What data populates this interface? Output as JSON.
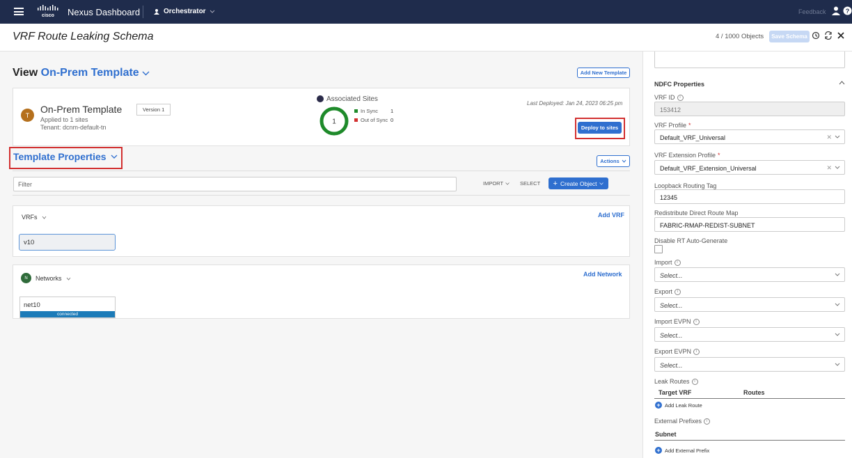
{
  "topbar": {
    "app_title": "Nexus Dashboard",
    "service": "Orchestrator",
    "feedback": "Feedback"
  },
  "header": {
    "title": "VRF Route Leaking Schema",
    "object_count": "4 / 1000 Objects",
    "save_label": "Save Schema"
  },
  "view": {
    "prefix": "View",
    "template_name": "On-Prem Template",
    "add_template_label": "Add New Template"
  },
  "template": {
    "avatar_letter": "T",
    "name": "On-Prem Template",
    "version": "Version 1",
    "applied": "Applied to 1 sites",
    "tenant": "Tenant: dcnm-default-tn",
    "associated_sites_label": "Associated Sites",
    "site_count": "1",
    "in_sync_label": "In Sync",
    "in_sync_count": "1",
    "out_of_sync_label": "Out of Sync",
    "out_of_sync_count": "0",
    "last_deployed": "Last Deployed: Jan 24, 2023 06:25 pm",
    "deploy_label": "Deploy to sites"
  },
  "template_properties": {
    "title": "Template Properties",
    "actions_label": "Actions",
    "filter_placeholder": "Filter",
    "import_label": "IMPORT",
    "select_label": "SELECT",
    "create_object_label": "Create Object"
  },
  "vrfs": {
    "title": "VRFs",
    "add_label": "Add VRF",
    "items": [
      "v10"
    ]
  },
  "networks": {
    "avatar_letter": "N",
    "title": "Networks",
    "add_label": "Add Network",
    "items": [
      {
        "name": "net10",
        "status": "connected"
      }
    ]
  },
  "ndfc": {
    "title": "NDFC Properties",
    "vrf_id_label": "VRF ID",
    "vrf_id_value": "153412",
    "vrf_profile_label": "VRF Profile",
    "vrf_profile_value": "Default_VRF_Universal",
    "vrf_ext_profile_label": "VRF Extension Profile",
    "vrf_ext_profile_value": "Default_VRF_Extension_Universal",
    "loopback_label": "Loopback Routing Tag",
    "loopback_value": "12345",
    "redistribute_label": "Redistribute Direct Route Map",
    "redistribute_value": "FABRIC-RMAP-REDIST-SUBNET",
    "disable_rt_label": "Disable RT Auto-Generate",
    "import_label": "Import",
    "export_label": "Export",
    "import_evpn_label": "Import EVPN",
    "export_evpn_label": "Export EVPN",
    "select_placeholder": "Select...",
    "leak_routes_label": "Leak Routes",
    "target_vrf_header": "Target VRF",
    "routes_header": "Routes",
    "add_leak_route_label": "Add Leak Route",
    "external_prefixes_label": "External Prefixes",
    "subnet_header": "Subnet",
    "add_external_prefix_label": "Add External Prefix"
  },
  "colors": {
    "topbar": "#1f2c4c",
    "accent": "#2f6fcf",
    "highlight": "#d22f2f",
    "in_sync": "#1e8a2a",
    "out_of_sync": "#d22f2f",
    "connected": "#1c7bb8"
  }
}
